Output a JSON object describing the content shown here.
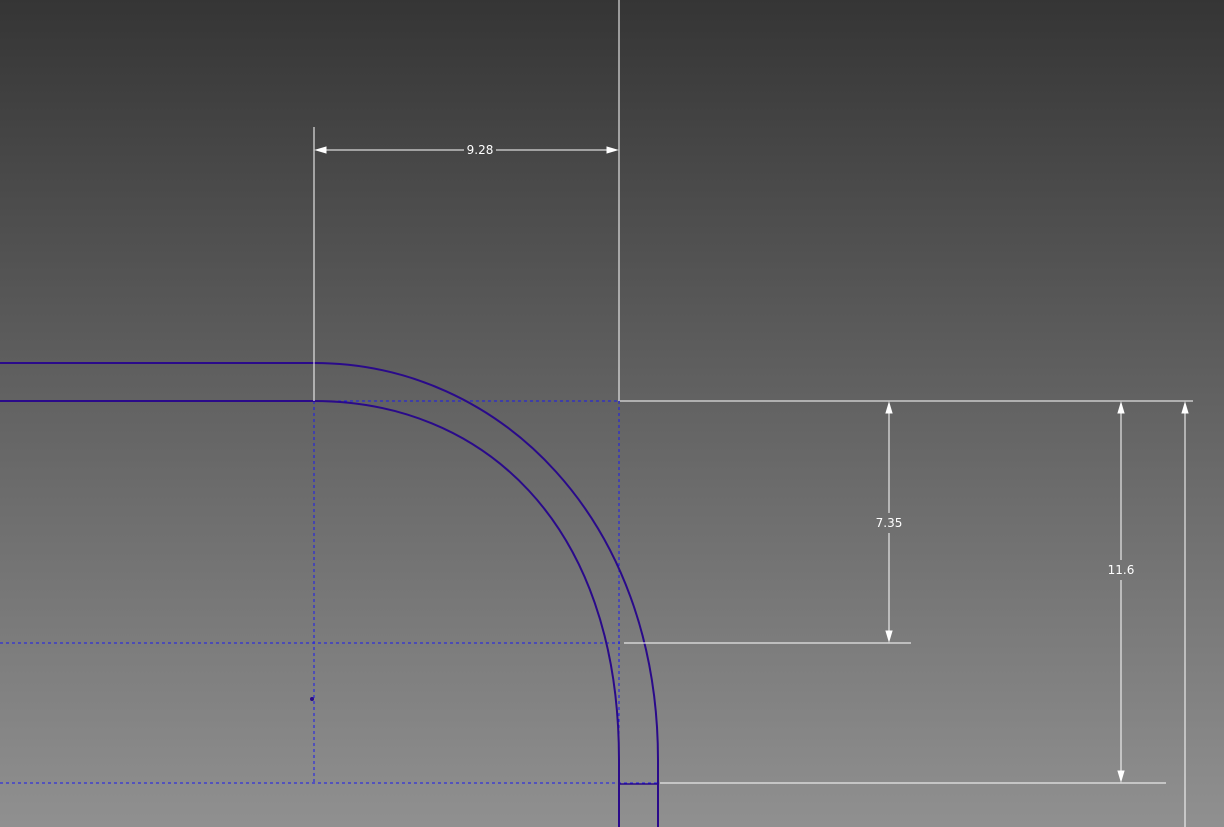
{
  "viewport": {
    "background_top": "#353535",
    "background_bottom": "#909090",
    "geometry_color": "#2a0a8a",
    "construction_color": "#1a1aee",
    "dimension_color": "#ffffff"
  },
  "dimensions": {
    "horizontal": {
      "value": "9.28"
    },
    "vertical_inner": {
      "value": "7.35"
    },
    "vertical_outer": {
      "value": "11.6"
    }
  },
  "icons": {
    "arrowheads": "dimension-arrow-icon",
    "center_point": "center-point-icon"
  }
}
